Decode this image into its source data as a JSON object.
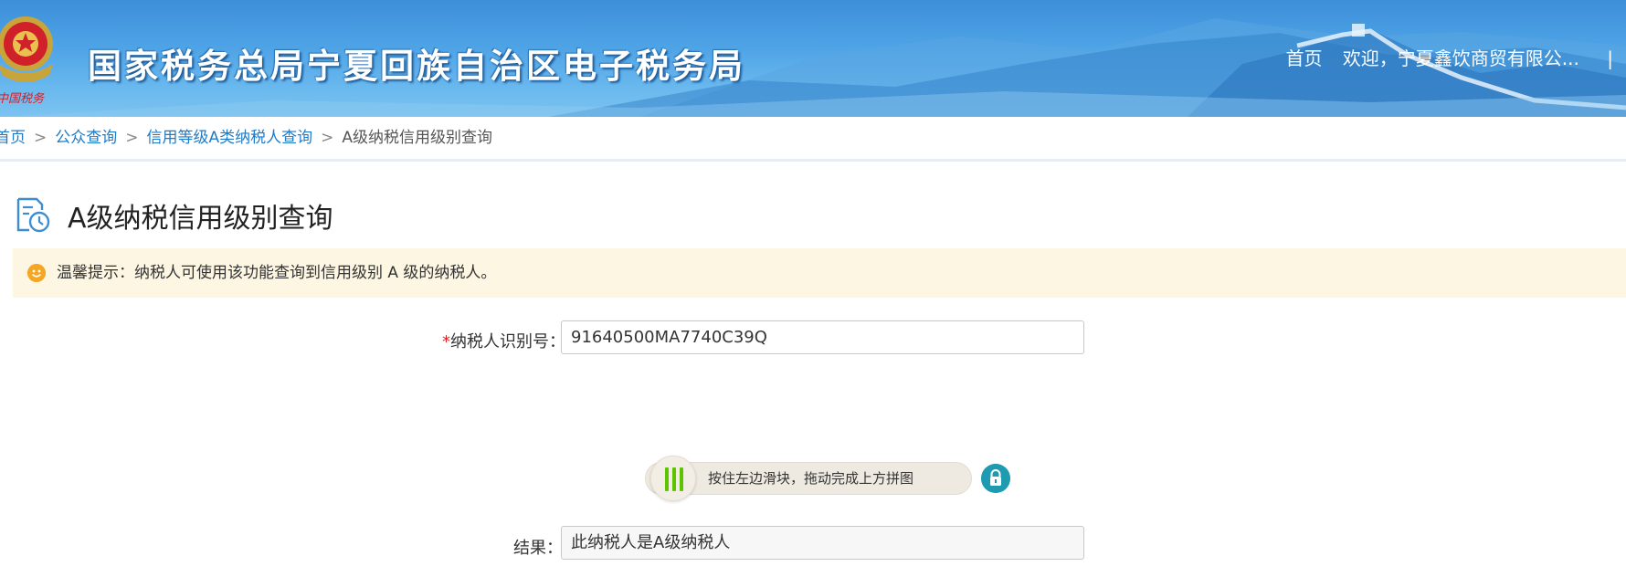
{
  "header": {
    "site_title": "国家税务总局宁夏回族自治区电子税务局",
    "emblem_text": "中国税务",
    "nav_home": "首页",
    "welcome": "欢迎，宁夏鑫饮商贸有限公...",
    "separator": "|"
  },
  "breadcrumb": {
    "items": [
      "首页",
      "公众查询",
      "信用等级A类纳税人查询"
    ],
    "current": "A级纳税信用级别查询",
    "arrow": ">"
  },
  "page": {
    "title": "A级纳税信用级别查询",
    "icon": "document-clock-icon"
  },
  "tip": {
    "icon": "smile-icon",
    "text": "温馨提示：纳税人可使用该功能查询到信用级别 A 级的纳税人。"
  },
  "form": {
    "taxpayer_id_required": "*",
    "taxpayer_id_label": "纳税人识别号：",
    "taxpayer_id_value": "91640500MA7740C39Q",
    "slider_hint": "按住左边滑块，拖动完成上方拼图",
    "slider_progress": 0,
    "result_label": "结果：",
    "result_value": "此纳税人是A级纳税人"
  },
  "colors": {
    "link": "#1f7bc8",
    "required": "#e02020",
    "tip_bg": "#fdf6e3",
    "slider_grip": "#5fc400",
    "lock_button": "#1e9bb0"
  }
}
